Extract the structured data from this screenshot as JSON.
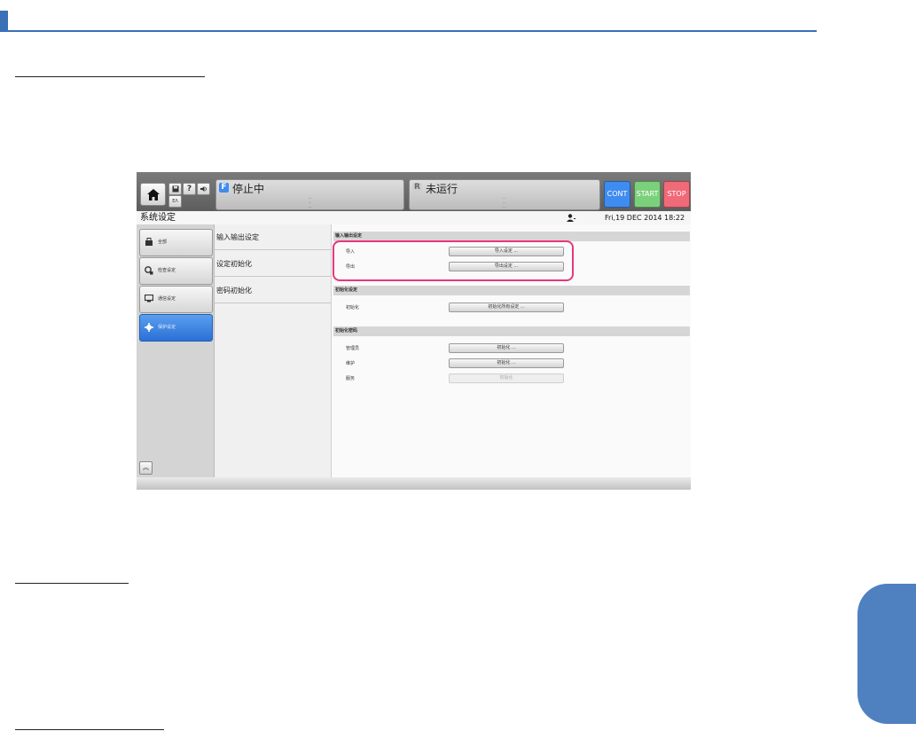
{
  "colors": {
    "accent_blue": "#3b6fb6",
    "highlight_pink": "#e8377d",
    "cont_blue": "#3f8cf1",
    "start_green": "#7bd17b",
    "stop_red": "#f06a78"
  },
  "screen": {
    "mini_buttons": {
      "help": "?",
      "language": "ΕΛ"
    },
    "status_primary": {
      "letter": "F",
      "title": "停止中",
      "info": [
        "...",
        "...",
        "..."
      ]
    },
    "status_secondary": {
      "letter": "R",
      "title": "未运行",
      "info": [
        "...",
        "...",
        "..."
      ]
    },
    "mode_buttons": {
      "cont": "CONT",
      "start": "START",
      "stop": "STOP"
    },
    "title": "系统设定",
    "datetime": "Fri,19 DEC 2014 18:22",
    "sidebar": [
      {
        "label": "全部",
        "icon": "all-icon"
      },
      {
        "label": "检查设定",
        "icon": "inspection-icon"
      },
      {
        "label": "通信设定",
        "icon": "communication-icon"
      },
      {
        "label": "保护设定",
        "icon": "gear-icon"
      }
    ],
    "submenu": [
      "输入输出设定",
      "设定初始化",
      "密码初始化"
    ],
    "sections": {
      "io": {
        "header": "输入输出设定",
        "rows": [
          {
            "label": "导入",
            "button": "导入设定 ..."
          },
          {
            "label": "导出",
            "button": "导出设定 ..."
          }
        ]
      },
      "init": {
        "header": "初始化设定",
        "rows": [
          {
            "label": "初始化",
            "button": "初始化所有设定 ..."
          }
        ]
      },
      "password": {
        "header": "初始化密码",
        "rows": [
          {
            "label": "管理员",
            "button": "初始化 ..."
          },
          {
            "label": "维护",
            "button": "初始化 ..."
          },
          {
            "label": "服务",
            "button": "初始化"
          }
        ]
      }
    }
  }
}
